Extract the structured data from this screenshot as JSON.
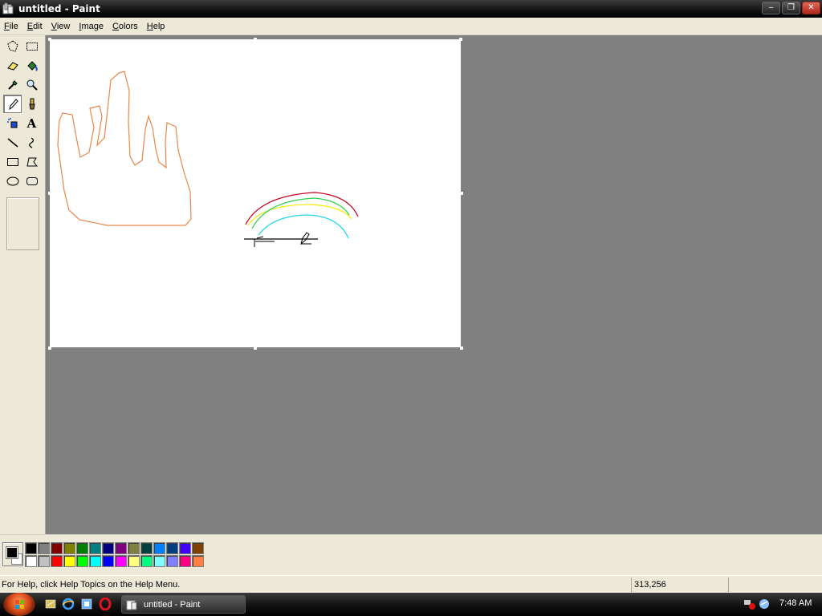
{
  "window": {
    "title": "untitled - Paint",
    "controls": {
      "minimize": "–",
      "maximize": "❐",
      "close": "✕"
    }
  },
  "menu": [
    {
      "accel": "F",
      "rest": "ile"
    },
    {
      "accel": "E",
      "rest": "dit"
    },
    {
      "accel": "V",
      "rest": "iew"
    },
    {
      "accel": "I",
      "rest": "mage"
    },
    {
      "accel": "C",
      "rest": "olors"
    },
    {
      "accel": "H",
      "rest": "elp"
    }
  ],
  "toolbox": {
    "tools": [
      {
        "name": "free-form-select-icon",
        "selected": false
      },
      {
        "name": "select-icon",
        "selected": false
      },
      {
        "name": "eraser-icon",
        "selected": false
      },
      {
        "name": "fill-with-color-icon",
        "selected": false
      },
      {
        "name": "pick-color-icon",
        "selected": false
      },
      {
        "name": "magnifier-icon",
        "selected": false
      },
      {
        "name": "pencil-icon",
        "selected": true
      },
      {
        "name": "brush-icon",
        "selected": false
      },
      {
        "name": "airbrush-icon",
        "selected": false
      },
      {
        "name": "text-icon",
        "selected": false,
        "glyph": "A"
      },
      {
        "name": "line-icon",
        "selected": false
      },
      {
        "name": "curve-icon",
        "selected": false
      },
      {
        "name": "rectangle-icon",
        "selected": false
      },
      {
        "name": "polygon-icon",
        "selected": false
      },
      {
        "name": "ellipse-icon",
        "selected": false
      },
      {
        "name": "rounded-rectangle-icon",
        "selected": false
      }
    ]
  },
  "colors": {
    "foreground": "#000000",
    "background": "#ffffff",
    "palette_top": [
      "#000000",
      "#808080",
      "#800000",
      "#808000",
      "#008000",
      "#008080",
      "#000080",
      "#800080",
      "#808040",
      "#004040",
      "#0080ff",
      "#004080",
      "#4000ff",
      "#804000"
    ],
    "palette_bottom": [
      "#ffffff",
      "#c0c0c0",
      "#ff0000",
      "#ffff00",
      "#00ff00",
      "#00ffff",
      "#0000ff",
      "#ff00ff",
      "#ffff80",
      "#00ff80",
      "#80ffff",
      "#8080ff",
      "#ff0080",
      "#ff8040"
    ]
  },
  "status": {
    "help_text": "For Help, click Help Topics on the Help Menu.",
    "coordinates": "313,256",
    "size": ""
  },
  "taskbar": {
    "task_label": "untitled - Paint",
    "clock": "7:48 AM"
  }
}
